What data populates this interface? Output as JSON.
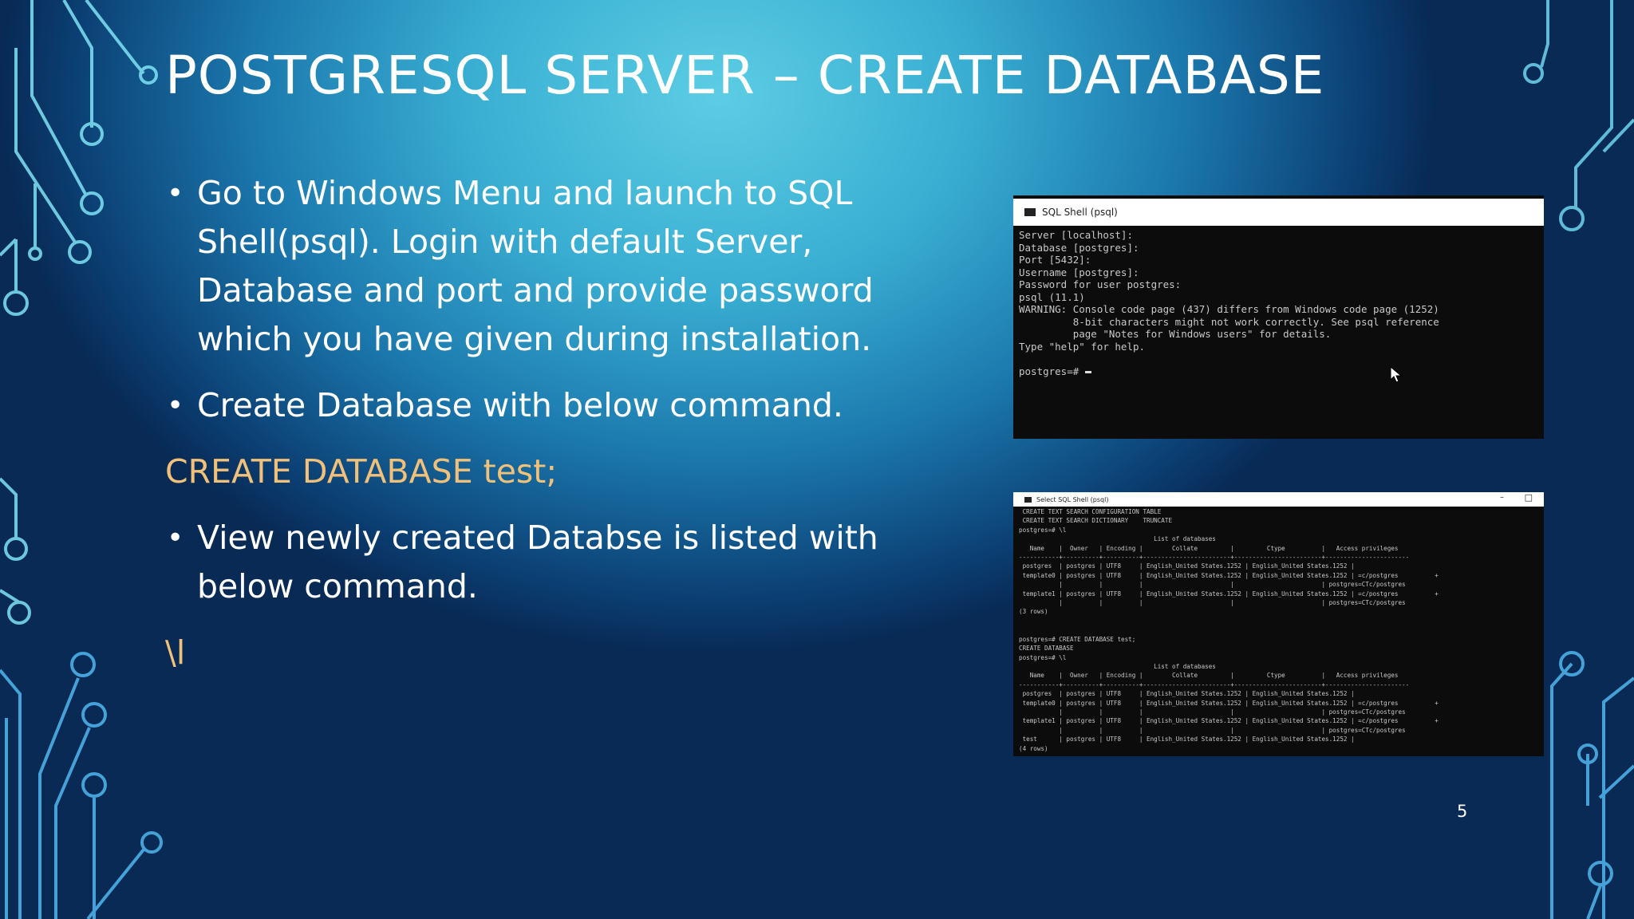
{
  "slide": {
    "title": "POSTGRESQL SERVER – CREATE DATABASE",
    "page_number": "5"
  },
  "content": {
    "bullet1": "Go to Windows Menu and launch to SQL Shell(psql). Login with default Server, Database and port and provide password which you have given during installation.",
    "bullet2": "Create Database with below command.",
    "code1": "CREATE DATABASE test;",
    "bullet3": "View newly created Databse is listed with below command.",
    "code2": "\\l"
  },
  "terminal1": {
    "title": "SQL Shell (psql)",
    "lines": [
      "Server [localhost]:",
      "Database [postgres]:",
      "Port [5432]:",
      "Username [postgres]:",
      "Password for user postgres:",
      "psql (11.1)",
      "WARNING: Console code page (437) differs from Windows code page (1252)",
      "         8-bit characters might not work correctly. See psql reference",
      "         page \"Notes for Windows users\" for details.",
      "Type \"help\" for help.",
      "",
      "postgres=# "
    ]
  },
  "terminal2": {
    "title": "Select SQL Shell (psql)",
    "minimize": "–",
    "maximize": "□",
    "lines": [
      " CREATE TEXT SEARCH CONFIGURATION TABLE",
      " CREATE TEXT SEARCH DICTIONARY    TRUNCATE",
      "postgres=# \\l",
      "                                     List of databases",
      "   Name    |  Owner   | Encoding |        Collate         |         Ctype          |   Access privileges",
      "-----------+----------+----------+------------------------+------------------------+-----------------------",
      " postgres  | postgres | UTF8     | English_United States.1252 | English_United States.1252 |",
      " template0 | postgres | UTF8     | English_United States.1252 | English_United States.1252 | =c/postgres          +",
      "           |          |          |                        |                        | postgres=CTc/postgres",
      " template1 | postgres | UTF8     | English_United States.1252 | English_United States.1252 | =c/postgres          +",
      "           |          |          |                        |                        | postgres=CTc/postgres",
      "(3 rows)",
      "",
      "",
      "postgres=# CREATE DATABASE test;",
      "CREATE DATABASE",
      "postgres=# \\l",
      "                                     List of databases",
      "   Name    |  Owner   | Encoding |        Collate         |         Ctype          |   Access privileges",
      "-----------+----------+----------+------------------------+------------------------+-----------------------",
      " postgres  | postgres | UTF8     | English_United States.1252 | English_United States.1252 |",
      " template0 | postgres | UTF8     | English_United States.1252 | English_United States.1252 | =c/postgres          +",
      "           |          |          |                        |                        | postgres=CTc/postgres",
      " template1 | postgres | UTF8     | English_United States.1252 | English_United States.1252 | =c/postgres          +",
      "           |          |          |                        |                        | postgres=CTc/postgres",
      " test      | postgres | UTF8     | English_United States.1252 | English_United States.1252 |",
      "(4 rows)"
    ]
  }
}
